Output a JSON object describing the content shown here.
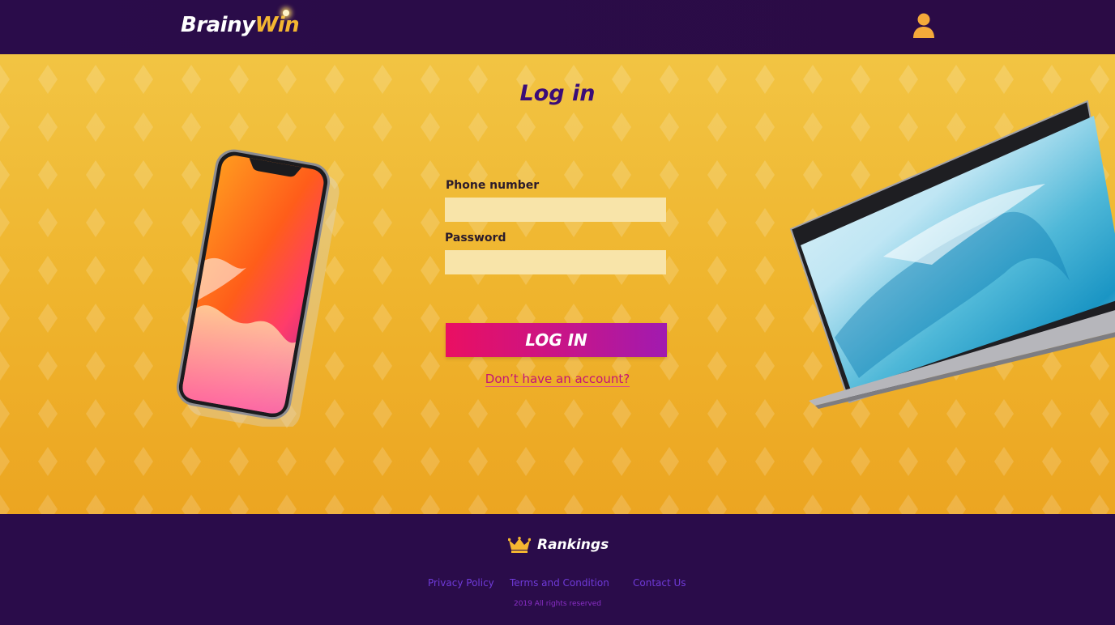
{
  "header": {
    "logo_part1": "Brainy",
    "logo_part2": "Win",
    "user_icon": "user-icon"
  },
  "login": {
    "title": "Log in",
    "phone_label": "Phone number",
    "phone_value": "",
    "password_label": "Password",
    "password_value": "",
    "submit_label": "LOG IN",
    "signup_link": "Don’t have an account?"
  },
  "footer": {
    "rankings_icon": "crown-icon",
    "rankings_label": "Rankings",
    "links": [
      "Privacy Policy",
      "Terms and Condition",
      "Contact Us"
    ],
    "copyright": "2019 All rights reserved"
  },
  "colors": {
    "header_bg": "#2a0c4a",
    "main_bg": "#efb52e",
    "title": "#3b0c78",
    "input_bg": "#f8e4a9",
    "button_start": "#ea0f62",
    "button_end": "#a11ab0",
    "link": "#c41475",
    "footer_link": "#6f3ad8",
    "accent": "#f4b631"
  }
}
